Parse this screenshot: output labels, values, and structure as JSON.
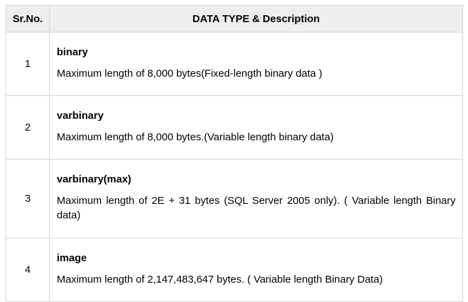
{
  "table": {
    "headers": {
      "sr_no": "Sr.No.",
      "data_type": "DATA TYPE & Description"
    },
    "rows": [
      {
        "sr": "1",
        "type": "binary",
        "description": "Maximum length of 8,000 bytes(Fixed-length binary data )"
      },
      {
        "sr": "2",
        "type": "varbinary",
        "description": "Maximum length of 8,000 bytes.(Variable length binary data)"
      },
      {
        "sr": "3",
        "type": "varbinary(max)",
        "description": "Maximum length of 2E + 31 bytes (SQL Server 2005 only). ( Variable length Binary data)"
      },
      {
        "sr": "4",
        "type": "image",
        "description": "Maximum length of 2,147,483,647 bytes. ( Variable length Binary Data)"
      }
    ]
  }
}
